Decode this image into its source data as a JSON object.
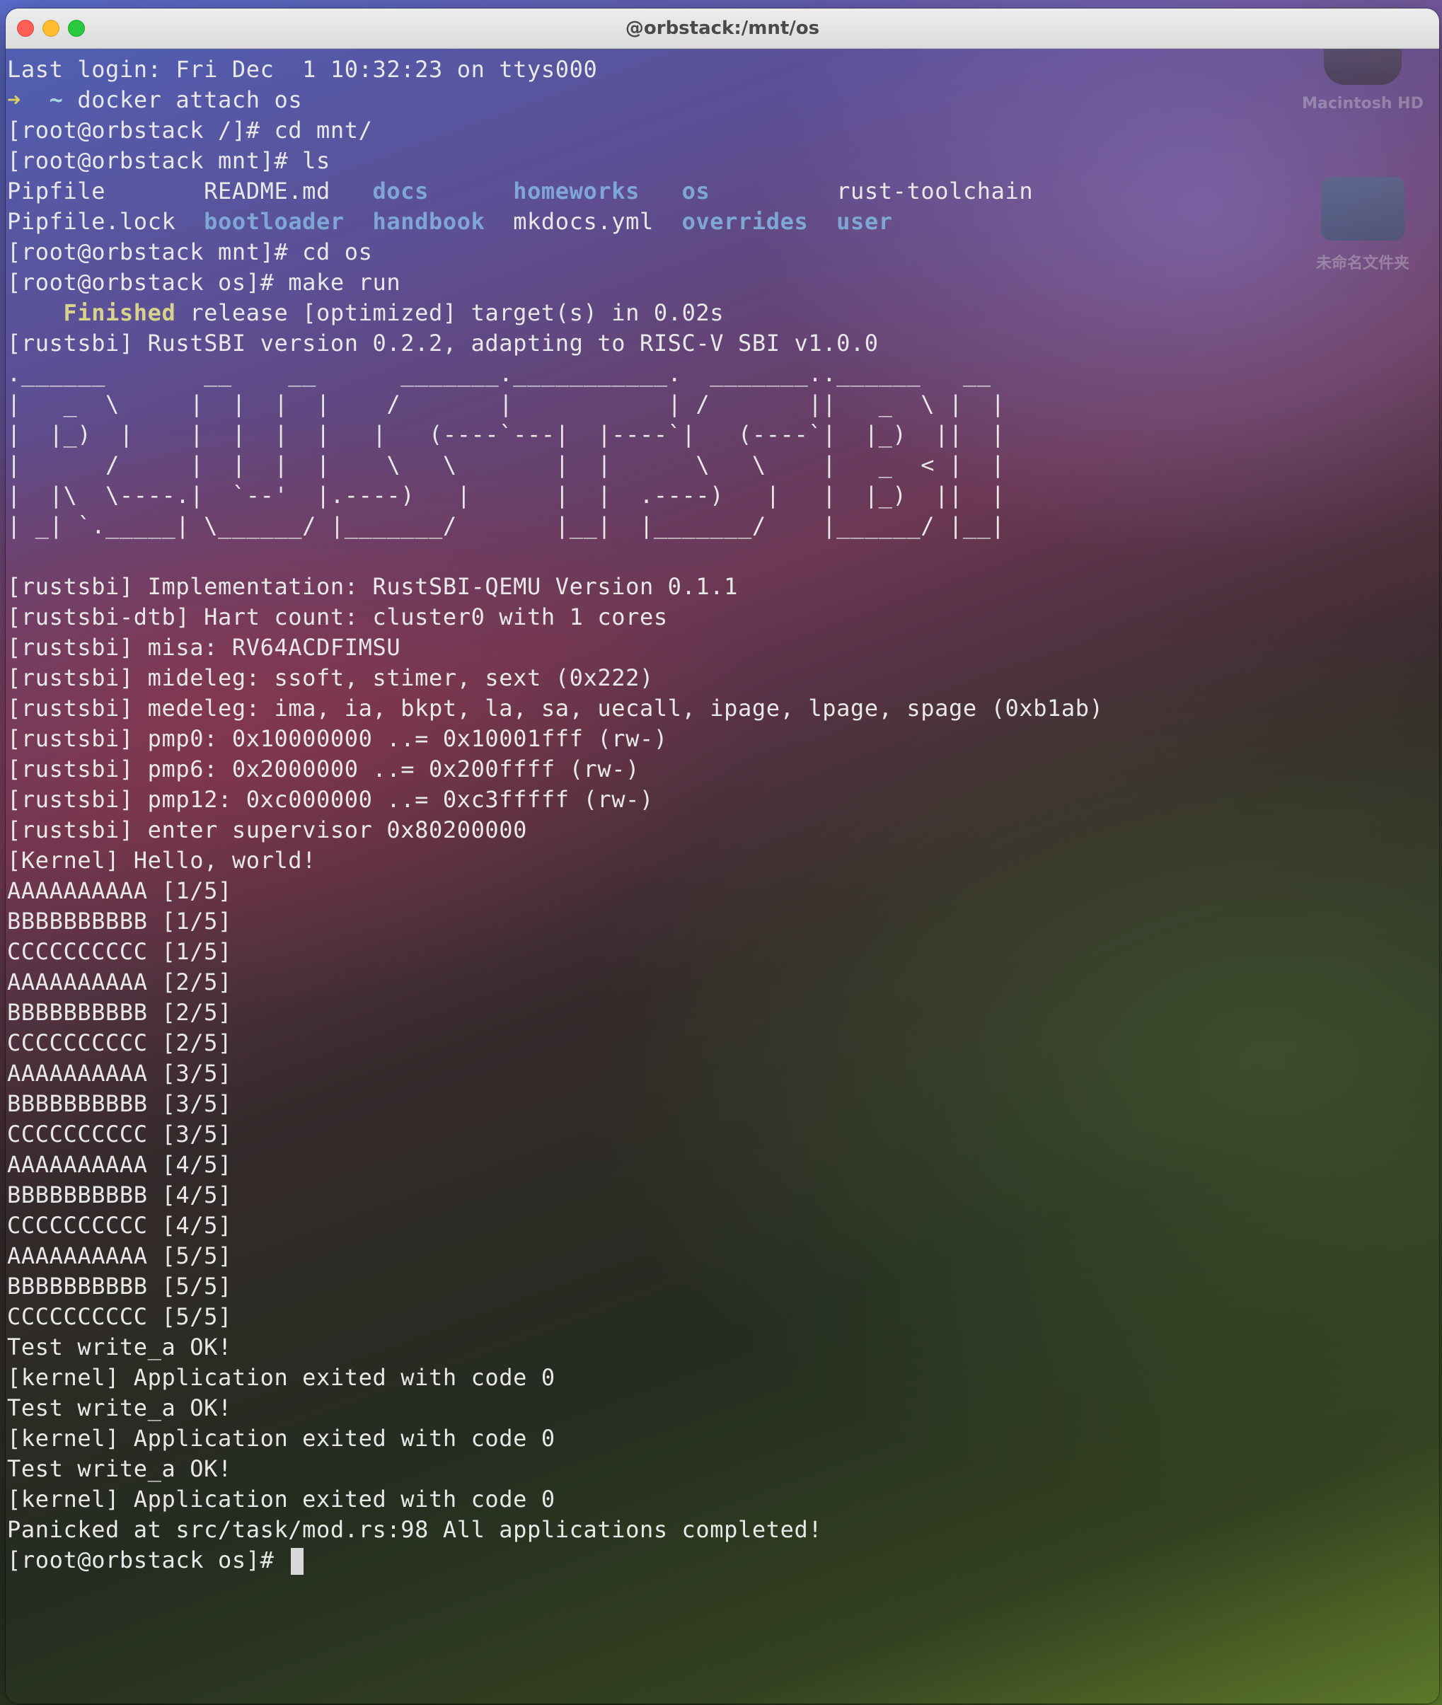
{
  "window": {
    "title": "@orbstack:/mnt/os"
  },
  "desktop": {
    "icons": [
      {
        "label": "Macintosh HD"
      },
      {
        "label": "未命名文件夹"
      }
    ]
  },
  "terminal": {
    "last_login": "Last login: Fri Dec  1 10:32:23 on ttys000",
    "cmd1_arrow": "➜",
    "cmd1_tilde": "~",
    "cmd1_text": "docker attach os",
    "cmd2": "[root@orbstack /]# cd mnt/",
    "cmd3": "[root@orbstack mnt]# ls",
    "ls": {
      "row1": [
        {
          "name": "Pipfile",
          "type": "file",
          "pad": "       "
        },
        {
          "name": "README.md",
          "type": "file",
          "pad": "   "
        },
        {
          "name": "docs",
          "type": "dir",
          "pad": "      "
        },
        {
          "name": "homeworks",
          "type": "dir",
          "pad": "   "
        },
        {
          "name": "os",
          "type": "dir",
          "pad": "         "
        },
        {
          "name": "rust-toolchain",
          "type": "file",
          "pad": ""
        }
      ],
      "row2": [
        {
          "name": "Pipfile.lock",
          "type": "file",
          "pad": "  "
        },
        {
          "name": "bootloader",
          "type": "dir",
          "pad": "  "
        },
        {
          "name": "handbook",
          "type": "dir",
          "pad": "  "
        },
        {
          "name": "mkdocs.yml",
          "type": "file",
          "pad": "  "
        },
        {
          "name": "overrides",
          "type": "dir",
          "pad": "  "
        },
        {
          "name": "user",
          "type": "dir",
          "pad": ""
        }
      ]
    },
    "cmd4": "[root@orbstack mnt]# cd os",
    "cmd5": "[root@orbstack os]# make run",
    "finished_indent": "    ",
    "finished_word": "Finished",
    "finished_rest": " release [optimized] target(s) in 0.02s",
    "rustsbi_version": "[rustsbi] RustSBI version 0.2.2, adapting to RISC-V SBI v1.0.0",
    "ascii_art": [
      ".______       __    __      _______.___________.  _______..______   __  ",
      "|   _  \\     |  |  |  |    /       |           | /       ||   _  \\ |  | ",
      "|  |_)  |    |  |  |  |   |   (----`---|  |----`|   (----`|  |_)  ||  | ",
      "|      /     |  |  |  |    \\   \\       |  |      \\   \\    |   _  < |  | ",
      "|  |\\  \\----.|  `--'  |.----)   |      |  |  .----)   |   |  |_)  ||  | ",
      "| _| `._____| \\______/ |_______/       |__|  |_______/    |______/ |__| "
    ],
    "output": [
      "[rustsbi] Implementation: RustSBI-QEMU Version 0.1.1",
      "[rustsbi-dtb] Hart count: cluster0 with 1 cores",
      "[rustsbi] misa: RV64ACDFIMSU",
      "[rustsbi] mideleg: ssoft, stimer, sext (0x222)",
      "[rustsbi] medeleg: ima, ia, bkpt, la, sa, uecall, ipage, lpage, spage (0xb1ab)",
      "[rustsbi] pmp0: 0x10000000 ..= 0x10001fff (rw-)",
      "[rustsbi] pmp6: 0x2000000 ..= 0x200ffff (rw-)",
      "[rustsbi] pmp12: 0xc000000 ..= 0xc3fffff (rw-)",
      "[rustsbi] enter supervisor 0x80200000",
      "[Kernel] Hello, world!",
      "AAAAAAAAAA [1/5]",
      "BBBBBBBBBB [1/5]",
      "CCCCCCCCCC [1/5]",
      "AAAAAAAAAA [2/5]",
      "BBBBBBBBBB [2/5]",
      "CCCCCCCCCC [2/5]",
      "AAAAAAAAAA [3/5]",
      "BBBBBBBBBB [3/5]",
      "CCCCCCCCCC [3/5]",
      "AAAAAAAAAA [4/5]",
      "BBBBBBBBBB [4/5]",
      "CCCCCCCCCC [4/5]",
      "AAAAAAAAAA [5/5]",
      "BBBBBBBBBB [5/5]",
      "CCCCCCCCCC [5/5]",
      "Test write_a OK!",
      "[kernel] Application exited with code 0",
      "Test write_a OK!",
      "[kernel] Application exited with code 0",
      "Test write_a OK!",
      "[kernel] Application exited with code 0",
      "Panicked at src/task/mod.rs:98 All applications completed!"
    ],
    "prompt": "[root@orbstack os]# "
  },
  "colors": {
    "directory": "#7fa7d6",
    "finished": "#d8d38a",
    "arrow": "#d8d060",
    "text": "#e8e8e8"
  }
}
